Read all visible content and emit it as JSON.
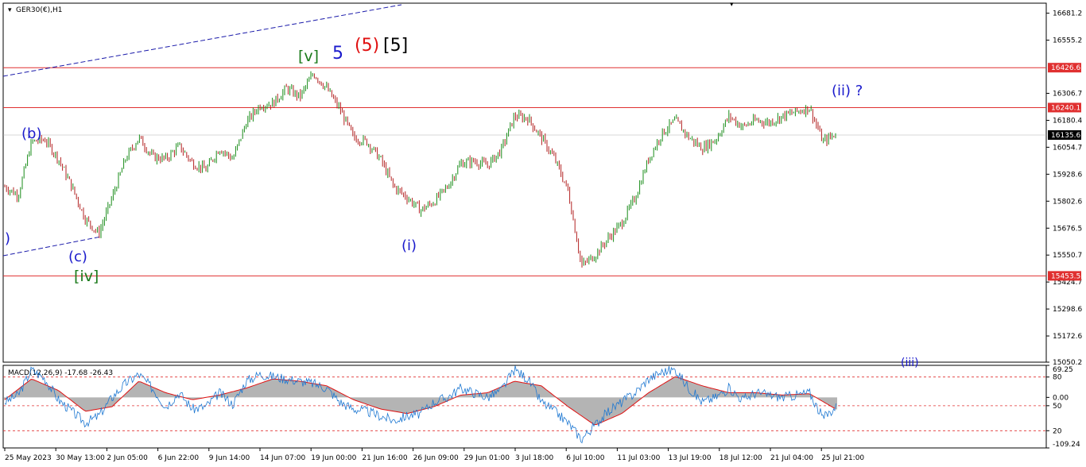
{
  "chart_data": [
    {
      "type": "candlestick",
      "symbol_label": "GER30(€),H1",
      "ylim": [
        15050.2,
        16728.0
      ],
      "y_ticks": [
        "16681.2",
        "16555.2",
        "16306.7",
        "16180.4",
        "16054.7",
        "15928.6",
        "15802.6",
        "15676.5",
        "15550.7",
        "15424.7",
        "15298.6",
        "15172.6",
        "15050.2"
      ],
      "x_ticks": [
        "25 May 2023",
        "30 May 13:00",
        "2 Jun 05:00",
        "6 Jun 22:00",
        "9 Jun 14:00",
        "14 Jun 07:00",
        "19 Jun 00:00",
        "21 Jun 16:00",
        "26 Jun 09:00",
        "29 Jun 01:00",
        "3 Jul 18:00",
        "6 Jul 10:00",
        "11 Jul 03:00",
        "13 Jul 19:00",
        "18 Jul 12:00",
        "21 Jul 04:00",
        "25 Jul 21:00"
      ],
      "current_price": "16135.6",
      "colors": {
        "up": "#1a8c1a",
        "down": "#b22222",
        "level": "#e03030",
        "trend": "#1a1aaa",
        "price_tag": "#000000"
      },
      "price_path": [
        [
          0,
          15870
        ],
        [
          1,
          15830
        ],
        [
          2,
          16080
        ],
        [
          3,
          16090
        ],
        [
          4,
          16000
        ],
        [
          5,
          15870
        ],
        [
          6,
          15720
        ],
        [
          7,
          15650
        ],
        [
          8,
          15820
        ],
        [
          9,
          16000
        ],
        [
          10,
          16100
        ],
        [
          11,
          16010
        ],
        [
          12,
          16000
        ],
        [
          13,
          16060
        ],
        [
          14,
          15980
        ],
        [
          15,
          15950
        ],
        [
          16,
          16050
        ],
        [
          17,
          16000
        ],
        [
          18,
          16170
        ],
        [
          19,
          16250
        ],
        [
          20,
          16260
        ],
        [
          21,
          16330
        ],
        [
          22,
          16290
        ],
        [
          23,
          16400
        ],
        [
          24,
          16330
        ],
        [
          25,
          16230
        ],
        [
          26,
          16100
        ],
        [
          27,
          16080
        ],
        [
          28,
          16000
        ],
        [
          29,
          15870
        ],
        [
          30,
          15820
        ],
        [
          31,
          15760
        ],
        [
          32,
          15800
        ],
        [
          33,
          15870
        ],
        [
          34,
          15980
        ],
        [
          35,
          15990
        ],
        [
          36,
          15970
        ],
        [
          37,
          16040
        ],
        [
          38,
          16200
        ],
        [
          39,
          16190
        ],
        [
          40,
          16100
        ],
        [
          41,
          16000
        ],
        [
          42,
          15850
        ],
        [
          43,
          15500
        ],
        [
          44,
          15550
        ],
        [
          45,
          15630
        ],
        [
          46,
          15700
        ],
        [
          47,
          15820
        ],
        [
          48,
          16000
        ],
        [
          49,
          16120
        ],
        [
          50,
          16180
        ],
        [
          51,
          16100
        ],
        [
          52,
          16050
        ],
        [
          53,
          16090
        ],
        [
          54,
          16200
        ],
        [
          55,
          16150
        ],
        [
          56,
          16180
        ],
        [
          57,
          16170
        ],
        [
          58,
          16200
        ],
        [
          59,
          16220
        ],
        [
          60,
          16240
        ],
        [
          61,
          16080
        ],
        [
          62,
          16120
        ]
      ],
      "levels": [
        {
          "label": "16426.6",
          "value": 16426.6
        },
        {
          "label": "16240.1",
          "value": 16240.1
        },
        {
          "label": "15453.5",
          "value": 15453.5
        }
      ],
      "wave_labels": [
        {
          "text": "[v]",
          "color": "#1a7a1a"
        },
        {
          "text": "5",
          "color": "#1a1acc"
        },
        {
          "text": "(5)",
          "color": "#e01010"
        },
        {
          "text": "[5]",
          "color": "#000000"
        },
        {
          "text": "(b)",
          "color": "#1a1acc"
        },
        {
          "text": "(c)",
          "color": "#1a1acc"
        },
        {
          "text": "[iv]",
          "color": "#1a7a1a"
        },
        {
          "text": ")",
          "color": "#1a1acc"
        },
        {
          "text": "(i)",
          "color": "#1a1acc"
        },
        {
          "text": "(ii) ?",
          "color": "#1a1acc"
        },
        {
          "text": "(iii)",
          "color": "#1a1acc"
        }
      ]
    },
    {
      "type": "line",
      "indicator_label": "MACD(12,26,9) -17.68 -26.43",
      "ylim": [
        -109.24,
        69.25
      ],
      "y_ticks": [
        "69.25",
        "80",
        "0.00",
        "50",
        "20",
        "-109.24"
      ],
      "colors": {
        "histogram": "#b4b4b4",
        "signal": "#e01010",
        "macd": "#1e78d2",
        "dotted": "#e03030"
      },
      "macd_path": [
        [
          0,
          -10
        ],
        [
          1,
          5
        ],
        [
          2,
          60
        ],
        [
          3,
          40
        ],
        [
          4,
          -5
        ],
        [
          5,
          -30
        ],
        [
          6,
          -55
        ],
        [
          7,
          -40
        ],
        [
          8,
          0
        ],
        [
          9,
          30
        ],
        [
          10,
          50
        ],
        [
          11,
          20
        ],
        [
          12,
          -20
        ],
        [
          13,
          10
        ],
        [
          14,
          -25
        ],
        [
          15,
          -20
        ],
        [
          16,
          10
        ],
        [
          17,
          -15
        ],
        [
          18,
          35
        ],
        [
          19,
          50
        ],
        [
          20,
          45
        ],
        [
          21,
          40
        ],
        [
          22,
          35
        ],
        [
          23,
          30
        ],
        [
          24,
          20
        ],
        [
          25,
          -10
        ],
        [
          26,
          -25
        ],
        [
          27,
          -30
        ],
        [
          28,
          -40
        ],
        [
          29,
          -50
        ],
        [
          30,
          -40
        ],
        [
          31,
          -35
        ],
        [
          32,
          -10
        ],
        [
          33,
          0
        ],
        [
          34,
          20
        ],
        [
          35,
          10
        ],
        [
          36,
          0
        ],
        [
          37,
          15
        ],
        [
          38,
          60
        ],
        [
          39,
          40
        ],
        [
          40,
          -10
        ],
        [
          41,
          -30
        ],
        [
          42,
          -55
        ],
        [
          43,
          -90
        ],
        [
          44,
          -60
        ],
        [
          45,
          -30
        ],
        [
          46,
          -10
        ],
        [
          47,
          10
        ],
        [
          48,
          40
        ],
        [
          49,
          55
        ],
        [
          50,
          60
        ],
        [
          51,
          20
        ],
        [
          52,
          -10
        ],
        [
          53,
          0
        ],
        [
          54,
          20
        ],
        [
          55,
          -5
        ],
        [
          56,
          10
        ],
        [
          57,
          5
        ],
        [
          58,
          0
        ],
        [
          59,
          5
        ],
        [
          60,
          10
        ],
        [
          61,
          -45
        ],
        [
          62,
          -20
        ]
      ],
      "signal_path": [
        [
          0,
          -5
        ],
        [
          2,
          40
        ],
        [
          4,
          15
        ],
        [
          6,
          -30
        ],
        [
          8,
          -20
        ],
        [
          10,
          35
        ],
        [
          12,
          10
        ],
        [
          14,
          -5
        ],
        [
          16,
          5
        ],
        [
          18,
          20
        ],
        [
          20,
          40
        ],
        [
          22,
          35
        ],
        [
          24,
          25
        ],
        [
          26,
          -5
        ],
        [
          28,
          -25
        ],
        [
          30,
          -35
        ],
        [
          32,
          -20
        ],
        [
          34,
          5
        ],
        [
          36,
          10
        ],
        [
          38,
          35
        ],
        [
          40,
          25
        ],
        [
          42,
          -20
        ],
        [
          44,
          -60
        ],
        [
          46,
          -35
        ],
        [
          48,
          10
        ],
        [
          50,
          45
        ],
        [
          52,
          25
        ],
        [
          54,
          10
        ],
        [
          56,
          10
        ],
        [
          58,
          5
        ],
        [
          60,
          8
        ],
        [
          62,
          -26
        ]
      ]
    }
  ]
}
